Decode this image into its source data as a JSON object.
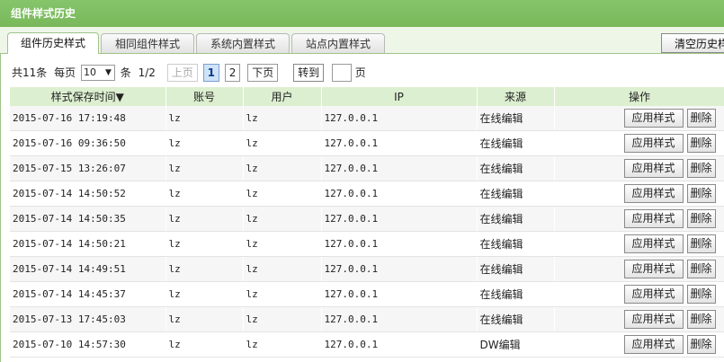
{
  "window": {
    "title": "组件样式历史"
  },
  "tabs": [
    {
      "label": "组件历史样式",
      "active": true
    },
    {
      "label": "相同组件样式",
      "active": false
    },
    {
      "label": "系统内置样式",
      "active": false
    },
    {
      "label": "站点内置样式",
      "active": false
    }
  ],
  "toolbar": {
    "clear_label": "清空历史样式"
  },
  "pager": {
    "total_prefix": "共11条",
    "per_page_label": "每页",
    "per_page_value": "10",
    "per_page_unit": "条",
    "page_info": "1/2",
    "prev_label": "上页",
    "pages": [
      "1",
      "2"
    ],
    "next_label": "下页",
    "goto_label": "转到",
    "page_suffix": "页"
  },
  "table": {
    "headers": [
      "样式保存时间▼",
      "账号",
      "用户",
      "IP",
      "来源",
      "操作"
    ],
    "action_apply": "应用样式",
    "action_delete": "删除",
    "rows": [
      {
        "time": "2015-07-16 17:19:48",
        "account": "lz",
        "user": "lz",
        "ip": "127.0.0.1",
        "source": "在线编辑"
      },
      {
        "time": "2015-07-16 09:36:50",
        "account": "lz",
        "user": "lz",
        "ip": "127.0.0.1",
        "source": "在线编辑"
      },
      {
        "time": "2015-07-15 13:26:07",
        "account": "lz",
        "user": "lz",
        "ip": "127.0.0.1",
        "source": "在线编辑"
      },
      {
        "time": "2015-07-14 14:50:52",
        "account": "lz",
        "user": "lz",
        "ip": "127.0.0.1",
        "source": "在线编辑"
      },
      {
        "time": "2015-07-14 14:50:35",
        "account": "lz",
        "user": "lz",
        "ip": "127.0.0.1",
        "source": "在线编辑"
      },
      {
        "time": "2015-07-14 14:50:21",
        "account": "lz",
        "user": "lz",
        "ip": "127.0.0.1",
        "source": "在线编辑"
      },
      {
        "time": "2015-07-14 14:49:51",
        "account": "lz",
        "user": "lz",
        "ip": "127.0.0.1",
        "source": "在线编辑"
      },
      {
        "time": "2015-07-14 14:45:37",
        "account": "lz",
        "user": "lz",
        "ip": "127.0.0.1",
        "source": "在线编辑"
      },
      {
        "time": "2015-07-13 17:45:03",
        "account": "lz",
        "user": "lz",
        "ip": "127.0.0.1",
        "source": "在线编辑"
      },
      {
        "time": "2015-07-10 14:57:30",
        "account": "lz",
        "user": "lz",
        "ip": "127.0.0.1",
        "source": "DW编辑"
      }
    ]
  },
  "colors": {
    "titlebar": "#7dbd60",
    "header_row": "#dcefd0",
    "tab_border": "#9fc48a"
  }
}
